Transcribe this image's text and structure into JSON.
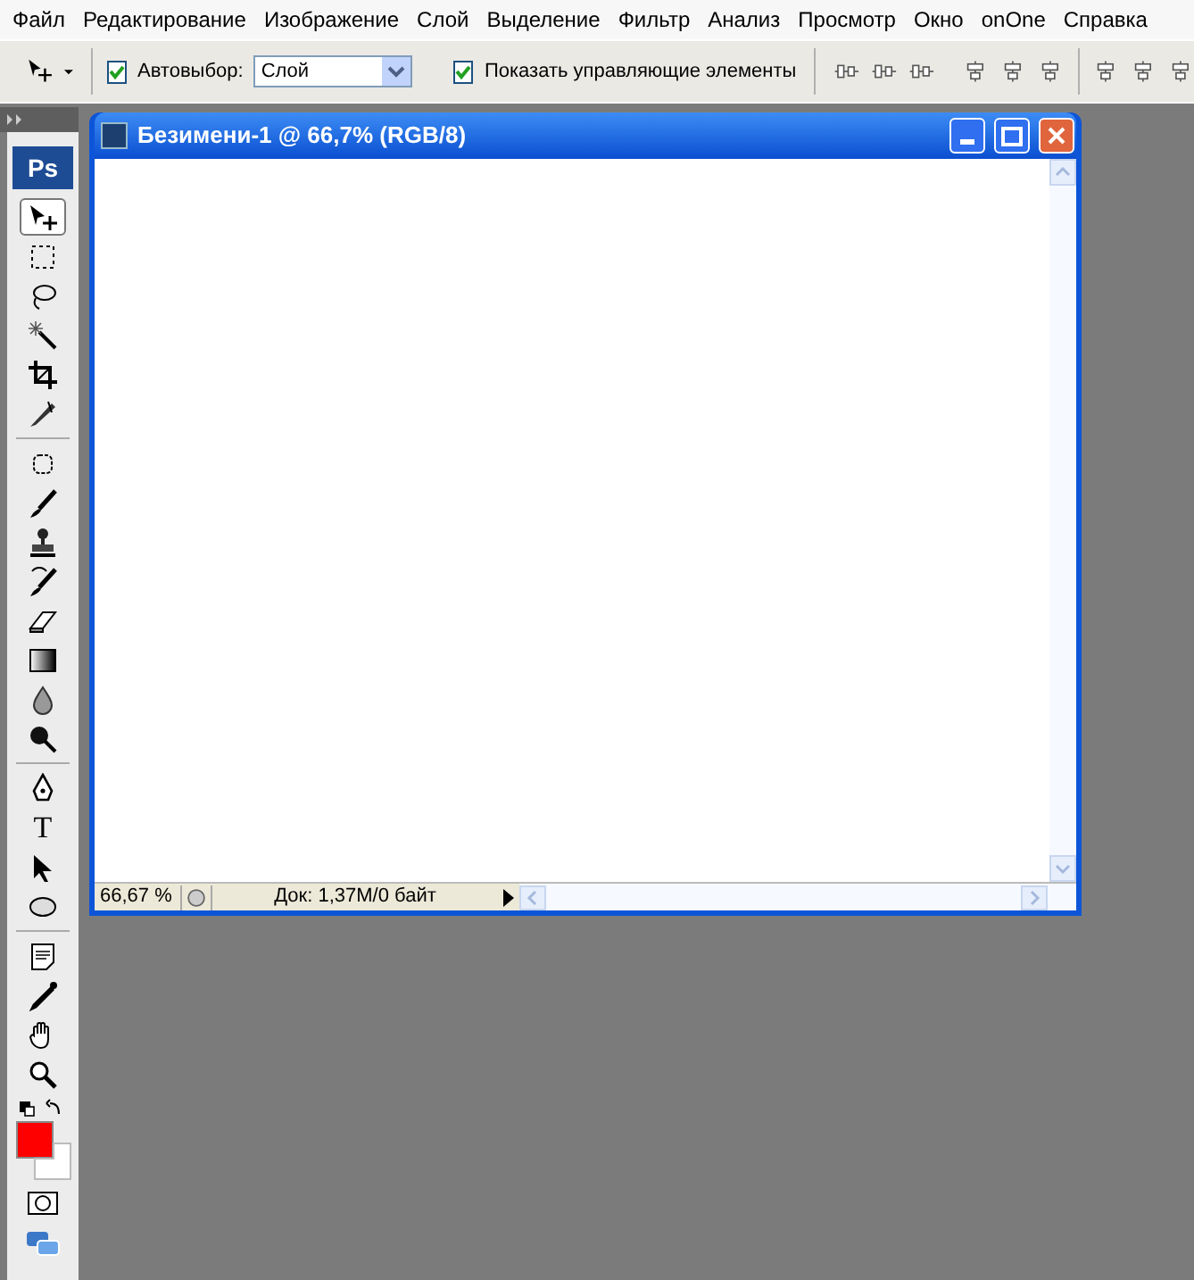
{
  "menu": [
    "Файл",
    "Редактирование",
    "Изображение",
    "Слой",
    "Выделение",
    "Фильтр",
    "Анализ",
    "Просмотр",
    "Окно",
    "onOne",
    "Справка"
  ],
  "options_bar": {
    "auto_select": {
      "label": "Автовыбор:",
      "checked": true,
      "value": "Слой"
    },
    "show_controls": {
      "label": "Показать управляющие элементы",
      "checked": true
    }
  },
  "toolbox": {
    "logo": "Ps",
    "tool_groups": [
      [
        {
          "kind": "move",
          "selected": true
        },
        {
          "kind": "marquee",
          "selected": false
        },
        {
          "kind": "lasso",
          "selected": false
        },
        {
          "kind": "wand",
          "selected": false
        },
        {
          "kind": "crop",
          "selected": false
        },
        {
          "kind": "slice",
          "selected": false
        }
      ],
      [
        {
          "kind": "heal",
          "selected": false
        },
        {
          "kind": "brush",
          "selected": false
        },
        {
          "kind": "stamp",
          "selected": false
        },
        {
          "kind": "history",
          "selected": false
        },
        {
          "kind": "eraser",
          "selected": false
        },
        {
          "kind": "gradient",
          "selected": false
        },
        {
          "kind": "blur",
          "selected": false
        },
        {
          "kind": "dodge",
          "selected": false
        }
      ],
      [
        {
          "kind": "pen",
          "selected": false
        },
        {
          "kind": "type",
          "selected": false,
          "glyph": "T"
        },
        {
          "kind": "path",
          "selected": false
        },
        {
          "kind": "shape",
          "selected": false
        }
      ],
      [
        {
          "kind": "notes",
          "selected": false
        },
        {
          "kind": "eyedropper",
          "selected": false
        },
        {
          "kind": "hand",
          "selected": false
        },
        {
          "kind": "zoom",
          "selected": false
        }
      ]
    ],
    "color_swatches": [
      {
        "kind": "foreground",
        "color": "#ff0000"
      },
      {
        "kind": "background",
        "color": "#ffffff"
      }
    ]
  },
  "document": {
    "title": "Безимени-1 @ 66,7% (RGB/8)",
    "zoom": "66,67 %",
    "doc_info": "Док: 1,37M/0 байт"
  }
}
